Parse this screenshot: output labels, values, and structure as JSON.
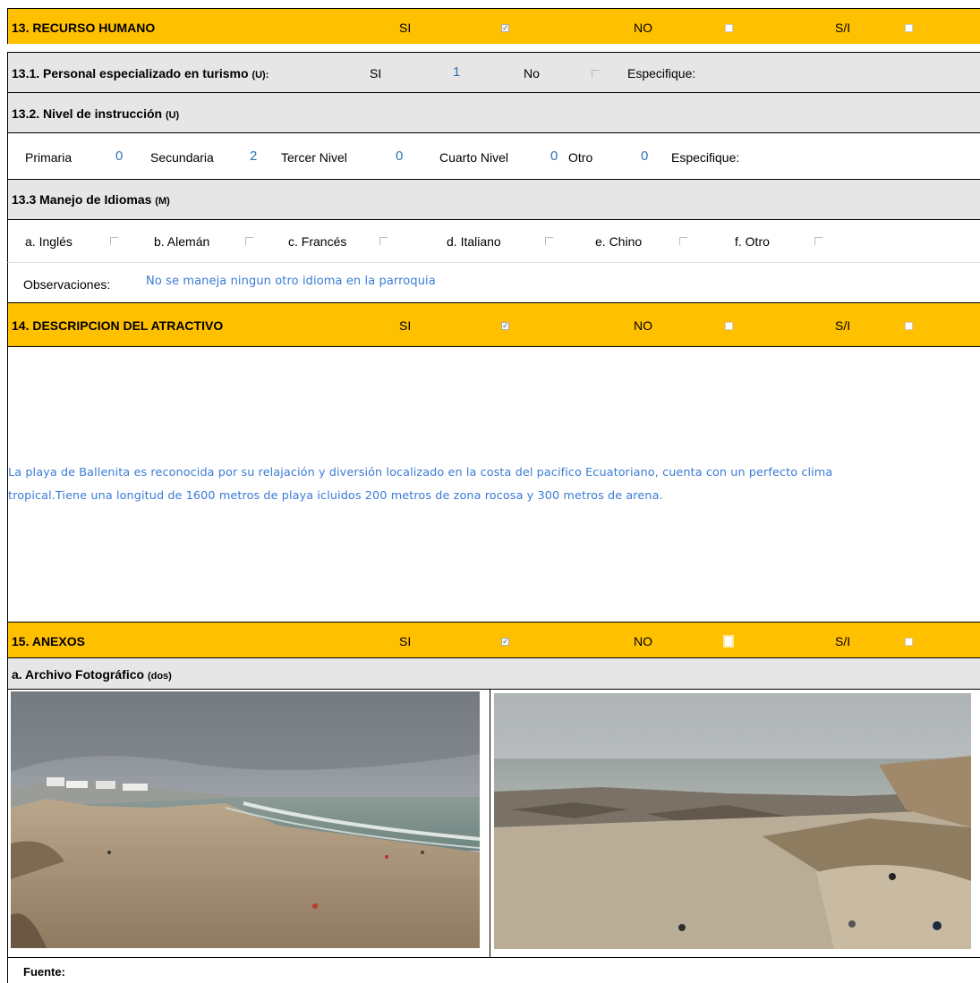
{
  "s13": {
    "title": "13. RECURSO HUMANO",
    "si": "SI",
    "no": "NO",
    "si_label": "S/I",
    "s131_label": "13.1. Personal especializado en turismo",
    "s131_code": "(U):",
    "s131_si": "SI",
    "s131_si_value": "1",
    "s131_no": "No",
    "s131_especifique": "Especifique:",
    "s132_label": "13.2. Nivel de instrucción",
    "s132_code": "(U)",
    "levels": [
      {
        "label": "Primaria",
        "value": "0"
      },
      {
        "label": "Secundaria",
        "value": "2"
      },
      {
        "label": "Tercer Nivel",
        "value": "0"
      },
      {
        "label": "Cuarto Nivel",
        "value": "0"
      },
      {
        "label": "Otro",
        "value": "0"
      }
    ],
    "levels_especifique": "Especifique:",
    "s133_label": "13.3 Manejo de Idiomas",
    "s133_code": "(M)",
    "languages": [
      "a. Inglés",
      "b. Alemán",
      "c. Francés",
      "d. Italiano",
      "e. Chino",
      "f. Otro"
    ],
    "obs_label": "Observaciones:",
    "obs_value": "No se maneja ningun otro idioma en la parroquia"
  },
  "s14": {
    "title": "14. DESCRIPCION DEL ATRACTIVO",
    "si": "SI",
    "no": "NO",
    "si_label": "S/I",
    "description_line1": "La playa de Ballenita es reconocida por su relajación y diversión localizado en la costa del pacifico Ecuatoriano, cuenta con un perfecto clima",
    "description_line2": "tropical.Tiene una longitud de 1600 metros de playa icluidos 200 metros de zona rocosa y 300 metros de arena."
  },
  "s15": {
    "title": "15. ANEXOS",
    "si": "SI",
    "no": "NO",
    "si_label": "S/I",
    "archivo_label": "a. Archivo Fotográfico",
    "archivo_code": "(dos)",
    "fuente": "Fuente:"
  },
  "colors": {
    "header": "#ffc000",
    "subheader": "#e6e6e6",
    "handwriting": "#3a7bd5"
  }
}
